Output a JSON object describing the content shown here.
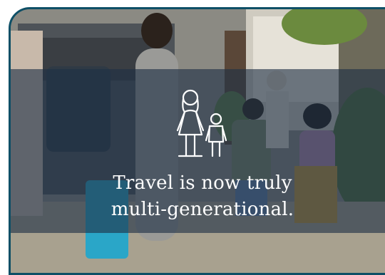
{
  "card": {
    "icon": "family-icon",
    "caption_line1": "Travel is now truly",
    "caption_line2": "multi-generational."
  },
  "colors": {
    "border": "#0e4f66",
    "overlay": "#1e3046",
    "text": "#ffffff",
    "suitcase": "#2aa6c8"
  }
}
